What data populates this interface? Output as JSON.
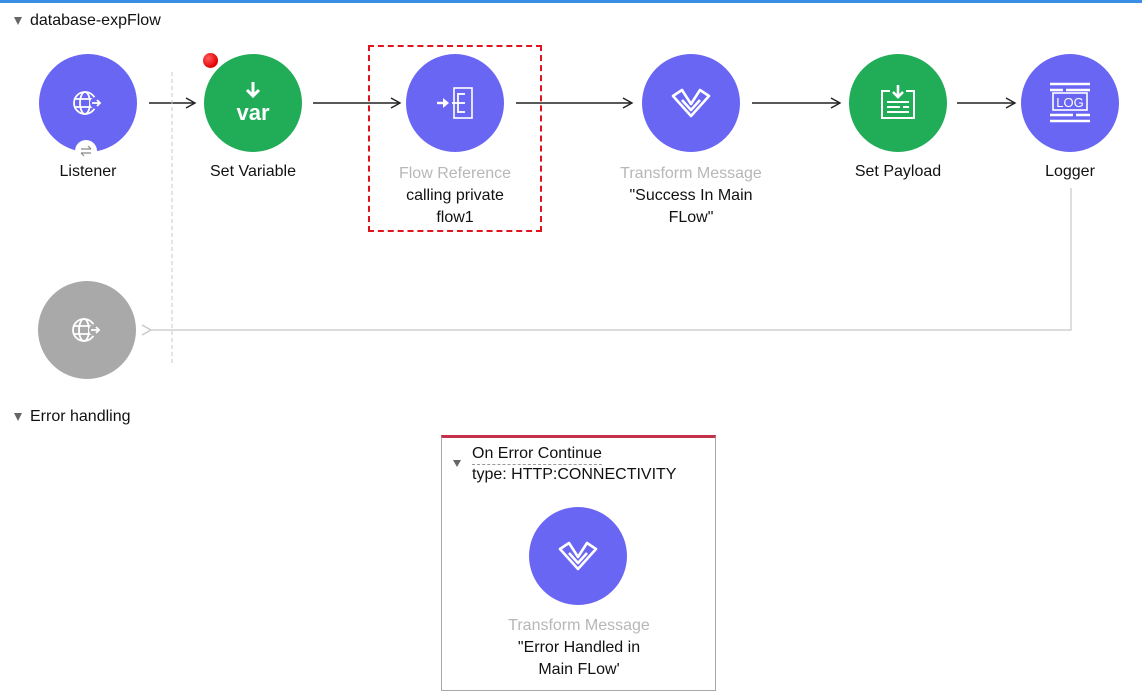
{
  "flow": {
    "name": "database-expFlow",
    "nodes": [
      {
        "id": "listener",
        "title": "Listener",
        "icon": "globe-arrow-icon",
        "color": "#6a66f4"
      },
      {
        "id": "set-variable",
        "title": "Set Variable",
        "icon": "var-icon",
        "color": "#21ad57"
      },
      {
        "id": "flow-reference",
        "title": "Flow Reference",
        "description": "calling private flow1",
        "icon": "flow-reference-icon",
        "color": "#6a66f4"
      },
      {
        "id": "transform-message",
        "title": "Transform Message",
        "description": "\"Success In Main FLow\"",
        "icon": "transform-icon",
        "color": "#6a66f4"
      },
      {
        "id": "set-payload",
        "title": "Set Payload",
        "icon": "set-payload-icon",
        "color": "#21ad57"
      },
      {
        "id": "logger",
        "title": "Logger",
        "icon": "log-icon",
        "color": "#6a66f4"
      }
    ],
    "response_node": {
      "icon": "globe-arrow-icon",
      "color": "#a9a9a9"
    }
  },
  "error_handling": {
    "label": "Error handling",
    "on_error": {
      "title": "On Error Continue",
      "type_label": "type: HTTP:CONNECTIVITY",
      "node": {
        "title": "Transform Message",
        "description": "\"Error Handled in Main FLow'",
        "icon": "transform-icon",
        "color": "#6a66f4"
      }
    }
  },
  "colors": {
    "accent_bar": "#3a8ee6",
    "selection": "#e0141c",
    "error_bar": "#c5314a"
  }
}
